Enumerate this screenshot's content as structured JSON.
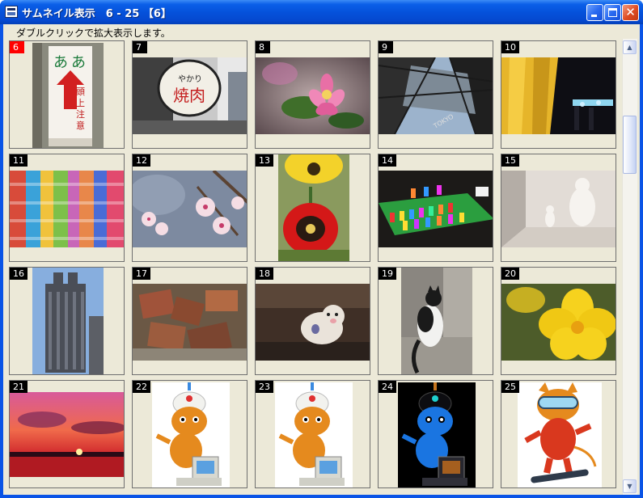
{
  "window": {
    "title": "サムネイル表示　6 - 25 【6】",
    "hint": "ダブルクリックで拡大表示します。"
  },
  "thumbnails": [
    {
      "number": "6",
      "subject": "warning sign (頭上注意)",
      "selected": true
    },
    {
      "number": "7",
      "subject": "round shop sign (焼肉)",
      "selected": false
    },
    {
      "number": "8",
      "subject": "pink flower",
      "selected": false
    },
    {
      "number": "9",
      "subject": "tower looking up",
      "selected": false
    },
    {
      "number": "10",
      "subject": "night illumination",
      "selected": false
    },
    {
      "number": "11",
      "subject": "paper cranes",
      "selected": false
    },
    {
      "number": "12",
      "subject": "cherry blossoms",
      "selected": false
    },
    {
      "number": "13",
      "subject": "tulips",
      "selected": false
    },
    {
      "number": "14",
      "subject": "figurine display",
      "selected": false
    },
    {
      "number": "15",
      "subject": "white sculpture",
      "selected": false
    },
    {
      "number": "16",
      "subject": "skyscraper",
      "selected": false
    },
    {
      "number": "17",
      "subject": "rusty scrap metal",
      "selected": false
    },
    {
      "number": "18",
      "subject": "pig figurine",
      "selected": false
    },
    {
      "number": "19",
      "subject": "black and white cat",
      "selected": false
    },
    {
      "number": "20",
      "subject": "yellow flower",
      "selected": false
    },
    {
      "number": "21",
      "subject": "sunset",
      "selected": false
    },
    {
      "number": "22",
      "subject": "cat character with computer",
      "selected": false
    },
    {
      "number": "23",
      "subject": "cat character with computer",
      "selected": false
    },
    {
      "number": "24",
      "subject": "cat character inverted colors",
      "selected": false
    },
    {
      "number": "25",
      "subject": "cat character snowboarding",
      "selected": false
    }
  ],
  "colors": {
    "titlebar": "#0552db",
    "client_bg": "#ece9d8",
    "number_badge": "#000000",
    "selected_badge": "#ff0000"
  },
  "icons": [
    "app-icon",
    "minimize-icon",
    "maximize-icon",
    "close-icon",
    "scroll-up-arrow-icon",
    "scroll-down-arrow-icon"
  ]
}
